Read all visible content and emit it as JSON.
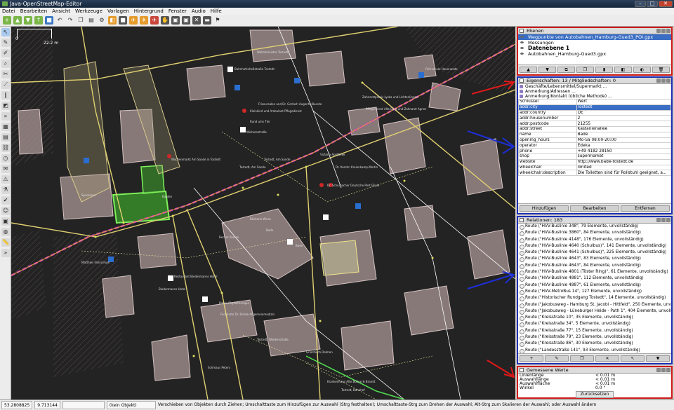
{
  "window": {
    "title": "Java-OpenStreetMap-Editor",
    "buttons": [
      "–",
      "□",
      "✕"
    ]
  },
  "menu": [
    "Datei",
    "Bearbeiten",
    "Ansicht",
    "Werkzeuge",
    "Vorlagen",
    "Hintergrund",
    "Fenster",
    "Audio",
    "Hilfe"
  ],
  "scale": {
    "left": "0",
    "right": "22.2 m"
  },
  "map_labels": {
    "l1": "Wallahmeister Tostedt",
    "l2": "Bahnhofscheßstraße Tostedt",
    "l3": "Friseursalon und Dr. Gerlach Augenheilkunde",
    "l4": "Kleinkind und Ambulant Pflegedienst",
    "l5": "Rund ums Tier",
    "l6": "Wichemstraße",
    "l7": "Wochenmarkt Am Sande in Tostedt",
    "l8": "Tostedt, Am Sande",
    "l9": "Tostedt, Am Sande",
    "l10": "Victoria Apotheke",
    "l11": "Dr. Kerstin Kreienkamp-Mertin",
    "l12": "Dr. Schumacher Deutsche Post Filiale",
    "l13": "Sparkasse",
    "l14": "Bauten",
    "l15": "Bäckerei Weiss",
    "l16": "Bade",
    "l17": "Becker Reisen",
    "l18": "Bade",
    "l19": "Matthies Fahrschule",
    "l20": "Restaurant Biedermanns Hotel",
    "l21": "Biedermanns Hotel",
    "l22": "Praxis Physiotherapie",
    "l23": "Fachärzte Dr. Rohde Allgemeinmedizin",
    "l24": "Tostedt, Wiedenstraße",
    "l25": "Griechisch Dolmen",
    "l26": "Schmaus Peters",
    "l27": "Krankenhaus Alte Bühne & Brandt",
    "l28": "Tostedt, Bahnhof",
    "l29": "Fahrschule Hauerwede",
    "l30": "Zahnarztpraxis Lyska und Lichtenlingen",
    "l31": "Pflegedienst Alte Burg und Zahnarzt Agnes"
  },
  "layers_panel": {
    "title": "Ebenen",
    "layers": [
      {
        "name": "Wegpunkte von Autobahnen_Hamburg-Gued3_POI.gpx",
        "selected": true
      },
      {
        "name": "Messungen",
        "selected": false
      },
      {
        "name": "Datenebene 1",
        "selected": false,
        "bold": true
      },
      {
        "name": "Autobahnen_Hamburg-Gued3.gpx",
        "selected": false
      }
    ]
  },
  "properties_panel": {
    "title": "Eigenschaften: 13 / Mitgliedschaften: 0",
    "presets": [
      "Geschäfte/Lebensmittel/Supermarkt ...",
      "Anmerkung/Adressen ...",
      "Anmerkung/Kontakt (übliche Methode) ..."
    ],
    "columns": [
      "Schlüssel",
      "Wert"
    ],
    "rows": [
      {
        "key": "addr:city",
        "value": "Tostedt",
        "selected": true
      },
      {
        "key": "addr:country",
        "value": "DE"
      },
      {
        "key": "addr:housenumber",
        "value": "2"
      },
      {
        "key": "addr:postcode",
        "value": "21255"
      },
      {
        "key": "addr:street",
        "value": "Kastanienallee"
      },
      {
        "key": "name",
        "value": "Bade"
      },
      {
        "key": "opening_hours",
        "value": "Mo-Sa 08:00-20:00"
      },
      {
        "key": "operator",
        "value": "Edeka"
      },
      {
        "key": "phone",
        "value": "+49 4182 28150"
      },
      {
        "key": "shop",
        "value": "supermarket"
      },
      {
        "key": "website",
        "value": "http://www.bade-tostedt.de"
      },
      {
        "key": "wheelchair",
        "value": "limited"
      },
      {
        "key": "wheelchair:description",
        "value": "Die Toiletten sind für Rollstuhl geeignet, a..."
      }
    ],
    "buttons": {
      "add": "Hinzufügen",
      "edit": "Bearbeiten",
      "remove": "Entfernen"
    }
  },
  "relations_panel": {
    "title": "Relationen: 183",
    "rows": [
      "Route (\"HVV-Buslinie 348\", 79 Elemente, unvollständig)",
      "Route (\"HVV-Buslinie 3860\", 84 Elemente, unvollständig)",
      "Route (\"HVV-Buslinie 4148\", 176 Elemente, unvollständig)",
      "Route (\"HVV-Buslinie 4640 (Schulbus)\", 141 Elemente, unvollständig)",
      "Route (\"HVV-Buslinie 4641 (Schulbus)\", 225 Elemente, unvollständig)",
      "Route (\"HVV-Buslinie 4643\", 83 Elemente, unvollständig)",
      "Route (\"HVV-Buslinie 4643\", 84 Elemente, unvollständig)",
      "Route (\"HVV-Buslinie 4801 (Töster Ring)\", 61 Elemente, unvollständig)",
      "Route (\"HVV-Buslinie 4881\", 112 Elemente, unvollständig)",
      "Route (\"HVV-Buslinie 4887\", 61 Elemente, unvollständig)",
      "Route (\"HVV-MetroBus 14\", 127 Elemente, unvollständig)",
      "Route (\"Historischer Rundgang Tostedt\", 14 Elemente, unvollständig)",
      "Route (\"Jakobusweg - Hamburg St. Jacobi - Hittfeld\", 250 Elemente, unvollständig)",
      "Route (\"Jakobusweg - Lüneburger Heide - Path 1\", 404 Elemente, unvollständig)",
      "Route (\"Kreisstraße 10\", 35 Elemente, unvollständig)",
      "Route (\"Kreisstraße 34\", 5 Elemente, unvollständig)",
      "Route (\"Kreisstraße 77\", 15 Elemente, unvollständig)",
      "Route (\"Kreisstraße 79\", 23 Elemente, unvollständig)",
      "Route (\"Kreisstraße 86\", 30 Elemente, unvollständig)",
      "Route (\"Landesstraße 141\", 93 Elemente, unvollständig)"
    ]
  },
  "measure_panel": {
    "title": "Gemessene Werte",
    "rows": [
      {
        "label": "Linienlänge",
        "value": "< 0.01 m"
      },
      {
        "label": "Auswahllänge",
        "value": "< 0.01 m"
      },
      {
        "label": "Auswahlfläche",
        "value": "< 0.01 m"
      },
      {
        "label": "Winkel",
        "value": "0.0 °"
      }
    ],
    "reset": "Zurücksetzen"
  },
  "statusbar": {
    "lat": "53.2808825",
    "lon": "9.713144",
    "angle": "",
    "object": "(kein Objekt)",
    "hint": "Verschieben von Objekten durch Ziehen; Umschalttaste zum Hinzufügen zur Auswahl (Strg festhalten); Umschalttaste-Strg zum Drehen der Auswahl; Alt-Strg zum Skalieren der Auswahl; oder Auswahl ändern"
  },
  "colors": {
    "panel_border_red": "#d0191a",
    "panel_border_blue": "#1d2fb5",
    "building_fill": "#a08f8f",
    "selected_green": "#3c9b2c",
    "track_magenta": "#c832c8",
    "arrow_red": "#e01818",
    "arrow_blue": "#1d2fd6"
  }
}
